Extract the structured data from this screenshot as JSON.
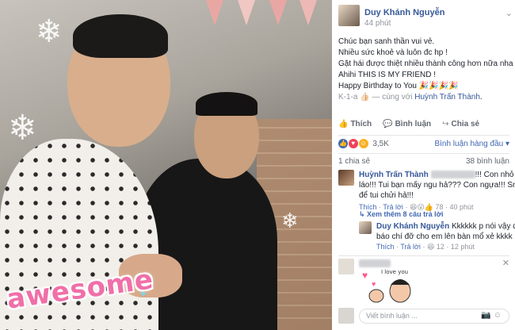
{
  "photo": {
    "sticker_text": "awesome"
  },
  "post": {
    "author": "Duy Khánh Nguyễn",
    "time": "44 phút",
    "lines": [
      "Chúc bạn sanh thần vui vẻ.",
      "Nhiều sức khoẻ và luôn đc hp !",
      "Gặt hái được thiệt nhiều thành công hơn nữa nha !",
      "Ahihi THIS IS MY FRIEND !",
      "Happy Birthday to You 🎉🎉🎉🎉"
    ],
    "last_line_prefix": "K-1-a 👍🏻 — cùng với",
    "tagged": "Huỳnh Trấn Thành",
    "tagged_suffix": "."
  },
  "actions": {
    "like": "Thích",
    "comment": "Bình luận",
    "share": "Chia sẻ"
  },
  "reactions": {
    "count": "3,5K",
    "sort_label": "Bình luận hàng đầu ▾",
    "colors": {
      "like": "#4267b2",
      "love": "#f0425b",
      "haha": "#f7b125"
    }
  },
  "shares": {
    "shares": "1 chia sẻ",
    "comments": "38 bình luận"
  },
  "comments": [
    {
      "author": "Huỳnh Trấn Thành",
      "text_line1": "!!! Con nhỏ hỗn",
      "text_line2": "láo!!! Tui bạn mấy ngu hả??? Con ngựa!!! Sn cũng",
      "text_line3": "để tui chửi hả!!!",
      "like": "Thích",
      "reply": "Trả lời",
      "reactions": "78",
      "time": "40 phút",
      "see_replies": "Xem thêm 8 câu trả lời"
    },
    {
      "author": "Duy Khánh Nguyễn",
      "text_line1": "Kkkkkk p nói vậy để",
      "text_line2": "báo chí đỡ cho em lên bàn mổ xẻ kkkk",
      "like": "Thích",
      "reply": "Trả lời",
      "reactions": "12",
      "time": "12 phút"
    },
    {
      "sticker_text": "I love you"
    }
  ],
  "compose": {
    "placeholder": "Viết bình luận ..."
  }
}
